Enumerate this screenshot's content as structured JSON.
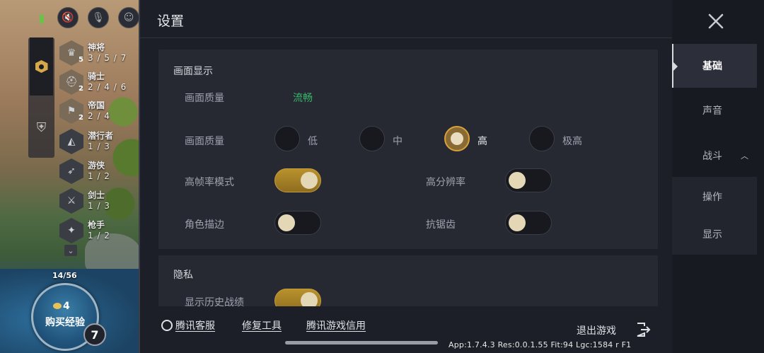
{
  "settings": {
    "title": "设置",
    "display_section": {
      "title": "画面显示",
      "quality_current_label": "画面质量",
      "quality_current_value": "流畅",
      "quality_label": "画面质量",
      "quality_options": [
        "低",
        "中",
        "高",
        "极高"
      ],
      "quality_selected": "高",
      "high_fps_label": "高帧率模式",
      "high_fps_on": true,
      "high_res_label": "高分辨率",
      "high_res_on": false,
      "outline_label": "角色描边",
      "outline_on": false,
      "antialias_label": "抗锯齿",
      "antialias_on": false
    },
    "privacy_section": {
      "title": "隐私",
      "history_label": "显示历史战绩",
      "history_on": true
    },
    "footer": {
      "support": "腾讯客服",
      "repair": "修复工具",
      "credit": "腾讯游戏信用",
      "exit": "退出游戏"
    },
    "debug": "App:1.7.4.3 Res:0.0.1.55 Fit:94 Lgc:1584 r F1"
  },
  "nav": {
    "items": [
      {
        "label": "基础",
        "selected": true
      },
      {
        "label": "声音"
      },
      {
        "label": "战斗",
        "expanded": true
      },
      {
        "label": "操作"
      },
      {
        "label": "显示"
      }
    ]
  },
  "game": {
    "traits": [
      {
        "name": "神将",
        "level": "5",
        "counts": "3 / 5 / 7",
        "icon": "crown-icon"
      },
      {
        "name": "骑士",
        "level": "2",
        "counts": "2 / 4 / 6",
        "icon": "helmet-icon"
      },
      {
        "name": "帝国",
        "level": "2",
        "counts": "2 / 4",
        "icon": "banner-icon"
      },
      {
        "name": "潜行者",
        "level": "",
        "counts": "1 / 3",
        "icon": "hood-icon"
      },
      {
        "name": "游侠",
        "level": "",
        "counts": "1 / 2",
        "icon": "bow-icon"
      },
      {
        "name": "剑士",
        "level": "",
        "counts": "1 / 3",
        "icon": "sword-icon"
      },
      {
        "name": "枪手",
        "level": "",
        "counts": "1 / 2",
        "icon": "gun-icon"
      }
    ],
    "exp_progress": "14/56",
    "buy_exp_cost": "4",
    "buy_exp_label": "购买经验",
    "player_level": "7"
  },
  "colors": {
    "accent_gold": "#d7a13c",
    "quality_green": "#37b66a",
    "panel_bg": "#1c1f28",
    "card_bg": "#262932"
  }
}
